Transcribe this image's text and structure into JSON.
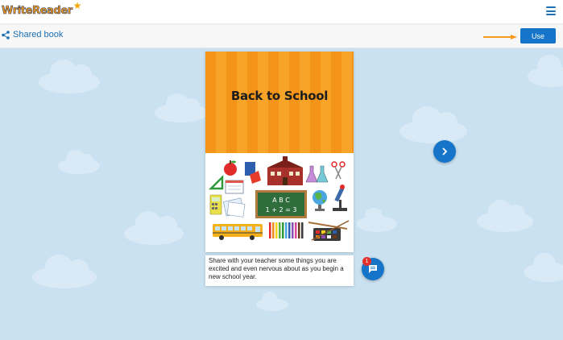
{
  "header": {
    "logo_text": "WriteReader",
    "menu_icon": "hamburger-menu-icon"
  },
  "toolbar": {
    "shared_label": "Shared book",
    "share_icon": "share-icon",
    "use_label": "Use",
    "arrow_icon": "arrow-right-icon"
  },
  "book": {
    "title": "Back to School",
    "chalkboard_line1": "A B C",
    "chalkboard_line2": "1 + 2 = 3",
    "caption": "Share with your teacher some things you are excited and even nervous about as you begin a new school year."
  },
  "comments": {
    "count": "1"
  },
  "colors": {
    "accent_blue": "#1675c8",
    "cover_orange": "#f49419",
    "background_sky": "#c9e1f0",
    "badge_red": "#e4312b"
  }
}
